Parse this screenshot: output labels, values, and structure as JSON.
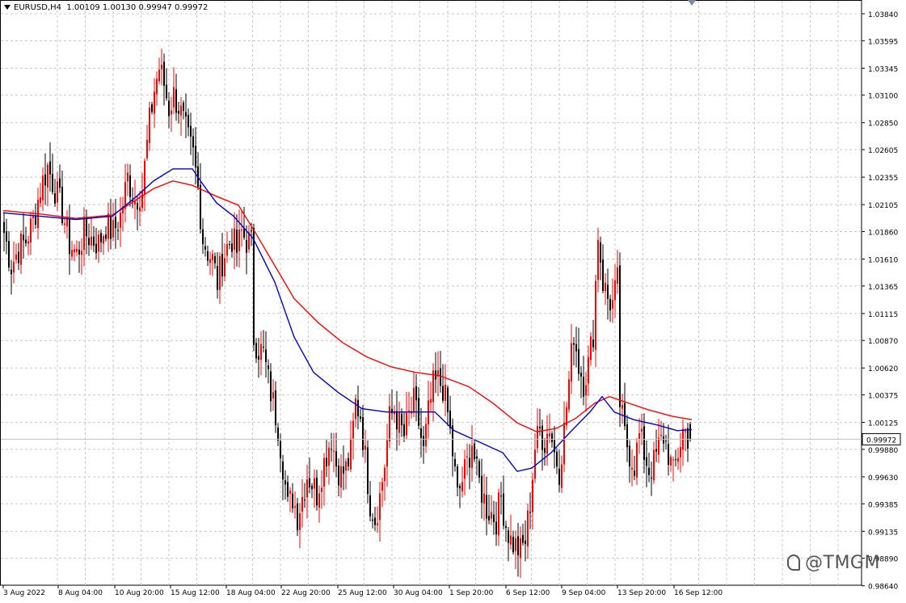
{
  "header": {
    "symbol": "EURUSD,H4",
    "open": "1.00109",
    "high": "1.00130",
    "low": "0.99947",
    "close": "0.99972"
  },
  "watermark": "@TMGM",
  "colors": {
    "bull": "#ff0000",
    "bear": "#000000",
    "ma_slow": "#ff0000",
    "ma_fast": "#0000cc",
    "grid": "#c8c8c8",
    "price_line": "#c0c0c0"
  },
  "chart_data": {
    "type": "candlestick",
    "symbol": "EURUSD",
    "timeframe": "H4",
    "current_price": "0.99972",
    "ylim": [
      0.98645,
      1.03965
    ],
    "y_ticks": [
      "1.03840",
      "1.03595",
      "1.03345",
      "1.03100",
      "1.02850",
      "1.02605",
      "1.02355",
      "1.02105",
      "1.01860",
      "1.01610",
      "1.01365",
      "1.01115",
      "1.00870",
      "1.00620",
      "1.00375",
      "1.00125",
      "0.99880",
      "0.99630",
      "0.99385",
      "0.99135",
      "0.98890",
      "0.98640"
    ],
    "x_ticks": [
      "3 Aug 2022",
      "8 Aug 04:00",
      "10 Aug 20:00",
      "15 Aug 12:00",
      "18 Aug 04:00",
      "22 Aug 20:00",
      "25 Aug 12:00",
      "30 Aug 04:00",
      "1 Sep 20:00",
      "6 Sep 12:00",
      "9 Sep 04:00",
      "13 Sep 20:00",
      "16 Sep 12:00"
    ],
    "close_points": [
      [
        0,
        1.0185
      ],
      [
        3,
        1.0155
      ],
      [
        6,
        1.017
      ],
      [
        9,
        1.0178
      ],
      [
        12,
        1.0195
      ],
      [
        15,
        1.0225
      ],
      [
        18,
        1.0245
      ],
      [
        21,
        1.0225
      ],
      [
        24,
        1.0205
      ],
      [
        27,
        1.0175
      ],
      [
        30,
        1.0165
      ],
      [
        33,
        1.0185
      ],
      [
        36,
        1.018
      ],
      [
        39,
        1.0175
      ],
      [
        42,
        1.0192
      ],
      [
        45,
        1.0185
      ],
      [
        48,
        1.02
      ],
      [
        51,
        1.0235
      ],
      [
        54,
        1.0215
      ],
      [
        57,
        1.0225
      ],
      [
        60,
        1.0285
      ],
      [
        62,
        1.0315
      ],
      [
        64,
        1.0335
      ],
      [
        66,
        1.032
      ],
      [
        68,
        1.0298
      ],
      [
        70,
        1.031
      ],
      [
        72,
        1.03
      ],
      [
        74,
        1.0285
      ],
      [
        76,
        1.0268
      ],
      [
        78,
        1.0255
      ],
      [
        80,
        1.0225
      ],
      [
        82,
        1.018
      ],
      [
        84,
        1.0168
      ],
      [
        86,
        1.016
      ],
      [
        88,
        1.014
      ],
      [
        90,
        1.016
      ],
      [
        92,
        1.0172
      ],
      [
        94,
        1.018
      ],
      [
        96,
        1.0168
      ],
      [
        98,
        1.0185
      ],
      [
        100,
        1.0178
      ],
      [
        102,
        1.0175
      ],
      [
        103,
        1.009
      ],
      [
        105,
        1.008
      ],
      [
        107,
        1.0075
      ],
      [
        109,
        1.005
      ],
      [
        111,
        1.003
      ],
      [
        113,
        1.001
      ],
      [
        115,
        0.9975
      ],
      [
        117,
        0.9935
      ],
      [
        119,
        0.9945
      ],
      [
        121,
        0.9928
      ],
      [
        123,
        0.9945
      ],
      [
        125,
        0.9965
      ],
      [
        127,
        0.9958
      ],
      [
        129,
        0.9948
      ],
      [
        131,
        0.9968
      ],
      [
        133,
        0.9985
      ],
      [
        135,
        1.0
      ],
      [
        137,
        0.9975
      ],
      [
        139,
        0.9965
      ],
      [
        141,
        0.997
      ],
      [
        143,
        0.9985
      ],
      [
        145,
        1.003
      ],
      [
        147,
        1.002
      ],
      [
        149,
        0.998
      ],
      [
        151,
        0.994
      ],
      [
        153,
        0.9925
      ],
      [
        155,
        0.9945
      ],
      [
        157,
        0.9975
      ],
      [
        159,
        1.0015
      ],
      [
        161,
        1.0025
      ],
      [
        163,
        1.001
      ],
      [
        165,
        1.0
      ],
      [
        167,
        1.0018
      ],
      [
        169,
        1.003
      ],
      [
        171,
        1.0012
      ],
      [
        173,
        0.9985
      ],
      [
        175,
        1.002
      ],
      [
        177,
        1.0045
      ],
      [
        179,
        1.005
      ],
      [
        181,
        1.0045
      ],
      [
        183,
        1.002
      ],
      [
        185,
        0.9985
      ],
      [
        187,
        0.9945
      ],
      [
        189,
        0.996
      ],
      [
        191,
        0.9975
      ],
      [
        193,
        0.9995
      ],
      [
        195,
        0.9965
      ],
      [
        197,
        0.995
      ],
      [
        199,
        0.9935
      ],
      [
        201,
        0.993
      ],
      [
        203,
        0.9925
      ],
      [
        205,
        0.9945
      ],
      [
        207,
        0.992
      ],
      [
        209,
        0.9905
      ],
      [
        211,
        0.99
      ],
      [
        213,
        0.9895
      ],
      [
        215,
        0.9905
      ],
      [
        217,
        0.994
      ],
      [
        219,
        0.999
      ],
      [
        221,
        1.0005
      ],
      [
        223,
        0.9995
      ],
      [
        225,
        1.001
      ],
      [
        227,
        0.9985
      ],
      [
        229,
        0.997
      ],
      [
        231,
        1.0005
      ],
      [
        233,
        1.005
      ],
      [
        235,
        1.0095
      ],
      [
        237,
        1.0065
      ],
      [
        239,
        1.005
      ],
      [
        241,
        1.0065
      ],
      [
        243,
        1.0095
      ],
      [
        245,
        1.0185
      ],
      [
        247,
        1.014
      ],
      [
        249,
        1.0125
      ],
      [
        251,
        1.012
      ],
      [
        253,
        1.014
      ],
      [
        254,
        1.003
      ],
      [
        256,
        1.0
      ],
      [
        258,
        0.9985
      ],
      [
        260,
        0.9975
      ],
      [
        262,
        1.0
      ],
      [
        264,
        0.9985
      ],
      [
        266,
        0.997
      ],
      [
        268,
        0.9975
      ],
      [
        270,
        0.999
      ],
      [
        272,
        1.0
      ],
      [
        274,
        0.9985
      ],
      [
        276,
        0.9965
      ],
      [
        278,
        0.9985
      ],
      [
        280,
        1.0005
      ],
      [
        282,
        1.0
      ],
      [
        283,
        0.99972
      ]
    ],
    "ma_fast": [
      [
        0,
        1.0203
      ],
      [
        15,
        1.02
      ],
      [
        30,
        1.0197
      ],
      [
        45,
        1.02
      ],
      [
        55,
        1.0218
      ],
      [
        62,
        1.0232
      ],
      [
        70,
        1.0243
      ],
      [
        78,
        1.0243
      ],
      [
        82,
        1.023
      ],
      [
        88,
        1.0212
      ],
      [
        95,
        1.02
      ],
      [
        103,
        1.018
      ],
      [
        112,
        1.014
      ],
      [
        120,
        1.009
      ],
      [
        128,
        1.0058
      ],
      [
        138,
        1.004
      ],
      [
        148,
        1.0025
      ],
      [
        158,
        1.0022
      ],
      [
        168,
        1.0022
      ],
      [
        178,
        1.0022
      ],
      [
        186,
        1.0005
      ],
      [
        196,
        0.9995
      ],
      [
        206,
        0.9985
      ],
      [
        212,
        0.9968
      ],
      [
        218,
        0.9971
      ],
      [
        226,
        0.9985
      ],
      [
        234,
        1.0004
      ],
      [
        242,
        1.0022
      ],
      [
        247,
        1.0036
      ],
      [
        252,
        1.0022
      ],
      [
        260,
        1.0015
      ],
      [
        270,
        1.001
      ],
      [
        278,
        1.0005
      ],
      [
        284,
        1.0006
      ]
    ],
    "ma_slow": [
      [
        0,
        1.0205
      ],
      [
        15,
        1.0202
      ],
      [
        30,
        1.0198
      ],
      [
        45,
        1.0201
      ],
      [
        55,
        1.0215
      ],
      [
        62,
        1.0225
      ],
      [
        70,
        1.0232
      ],
      [
        78,
        1.0228
      ],
      [
        88,
        1.0218
      ],
      [
        97,
        1.021
      ],
      [
        104,
        1.0185
      ],
      [
        112,
        1.0155
      ],
      [
        120,
        1.0125
      ],
      [
        130,
        1.0103
      ],
      [
        140,
        1.0085
      ],
      [
        150,
        1.0072
      ],
      [
        160,
        1.0063
      ],
      [
        170,
        1.0058
      ],
      [
        180,
        1.0055
      ],
      [
        192,
        1.0045
      ],
      [
        202,
        1.003
      ],
      [
        212,
        1.0012
      ],
      [
        220,
        1.0004
      ],
      [
        228,
        1.0007
      ],
      [
        236,
        1.0016
      ],
      [
        244,
        1.003
      ],
      [
        250,
        1.0036
      ],
      [
        258,
        1.003
      ],
      [
        266,
        1.0024
      ],
      [
        276,
        1.0018
      ],
      [
        284,
        1.0015
      ]
    ]
  }
}
